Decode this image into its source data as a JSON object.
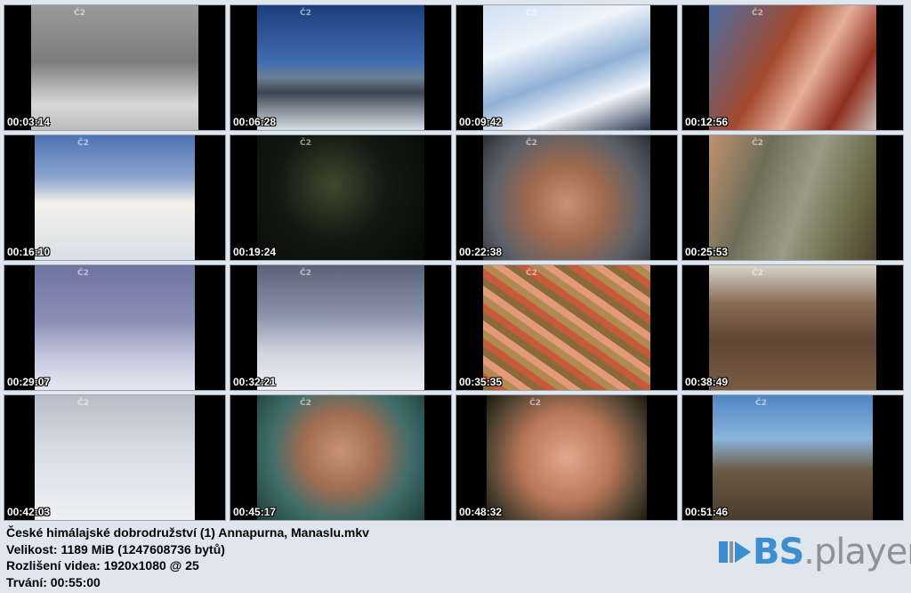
{
  "thumbnails": [
    {
      "time": "00:03:14",
      "style": "s1",
      "frame": "full"
    },
    {
      "time": "00:06:28",
      "style": "s2",
      "frame": "full"
    },
    {
      "time": "00:09:42",
      "style": "s3",
      "frame": "full"
    },
    {
      "time": "00:12:56",
      "style": "s4",
      "frame": "full"
    },
    {
      "time": "00:16:10",
      "style": "s5",
      "frame": "crop"
    },
    {
      "time": "00:19:24",
      "style": "s6",
      "frame": "full"
    },
    {
      "time": "00:22:38",
      "style": "s7",
      "frame": "full"
    },
    {
      "time": "00:25:53",
      "style": "s8",
      "frame": "full"
    },
    {
      "time": "00:29:07",
      "style": "s9",
      "frame": "crop"
    },
    {
      "time": "00:32:21",
      "style": "s10",
      "frame": "full"
    },
    {
      "time": "00:35:35",
      "style": "s11",
      "frame": "full"
    },
    {
      "time": "00:38:49",
      "style": "s12",
      "frame": "full"
    },
    {
      "time": "00:42:03",
      "style": "s13",
      "frame": "crop"
    },
    {
      "time": "00:45:17",
      "style": "s14",
      "frame": "full"
    },
    {
      "time": "00:48:32",
      "style": "s15",
      "frame": "crop"
    },
    {
      "time": "00:51:46",
      "style": "s16",
      "frame": "crop"
    }
  ],
  "channel_logo": "Č2",
  "info": {
    "filename": "České himálajské dobrodružství (1) Annapurna, Manaslu.mkv",
    "size": "Velikost: 1189 MiB (1247608736 bytů)",
    "resolution": "Rozlišení videa: 1920x1080 @ 25",
    "duration": "Trvání: 00:55:00"
  },
  "brand": {
    "bs": "BS",
    "player": ".player",
    "colors": {
      "bs": "#3d8ecf",
      "player": "#8e9298"
    }
  }
}
